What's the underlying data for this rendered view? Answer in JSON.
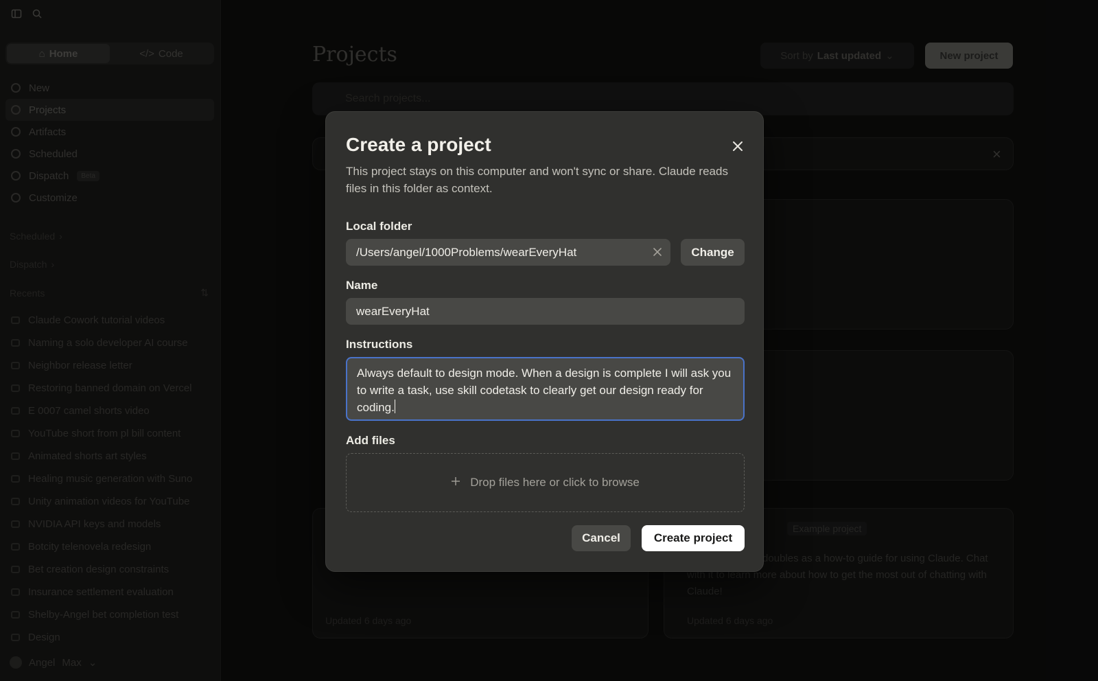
{
  "sidebar": {
    "modes": [
      {
        "label": "Home"
      },
      {
        "label": "Code"
      }
    ],
    "nav": [
      {
        "label": "New"
      },
      {
        "label": "Projects"
      },
      {
        "label": "Artifacts"
      },
      {
        "label": "Scheduled"
      },
      {
        "label": "Dispatch",
        "badge": "Beta"
      },
      {
        "label": "Customize"
      }
    ],
    "sections": {
      "scheduled": "Scheduled",
      "dispatch": "Dispatch",
      "recents": "Recents"
    },
    "recents": [
      "Claude Cowork tutorial videos",
      "Naming a solo developer AI course",
      "Neighbor release letter",
      "Restoring banned domain on Vercel",
      "E 0007 camel shorts video",
      "YouTube short from pl bill content",
      "Animated shorts art styles",
      "Healing music generation with Suno",
      "Unity animation videos for YouTube",
      "NVIDIA API keys and models",
      "Botcity telenovela redesign",
      "Bet creation design constraints",
      "Insurance settlement evaluation",
      "Shelby-Angel bet completion test",
      "Design"
    ],
    "user": {
      "name": "Angel",
      "plan": "Max"
    }
  },
  "main": {
    "title": "Projects",
    "sort_prefix": "Sort by",
    "sort_value": "Last updated",
    "new_project": "New project",
    "search_placeholder": "Search projects...",
    "cards": {
      "updated_a": "Updated 6 days ago",
      "updated_b": "Updated 6 days ago",
      "example_badge": "Example project",
      "example_desc": "project that also doubles as a how-to guide for using Claude. Chat with it to learn more about how to get the most out of chatting with Claude!"
    }
  },
  "modal": {
    "title": "Create a project",
    "description": "This project stays on this computer and won't sync or share. Claude reads files in this folder as context.",
    "folder_label": "Local folder",
    "folder_value": "/Users/angel/1000Problems/wearEveryHat",
    "change_label": "Change",
    "name_label": "Name",
    "name_value": "wearEveryHat",
    "instructions_label": "Instructions",
    "instructions_value": "Always default to design mode. When a design is complete I will ask you to write a task, use skill codetask to clearly get our design ready for coding.",
    "files_label": "Add files",
    "drop_text": "Drop files here or click to browse",
    "cancel_label": "Cancel",
    "create_label": "Create project",
    "accent_focus": "#4a73c9"
  }
}
